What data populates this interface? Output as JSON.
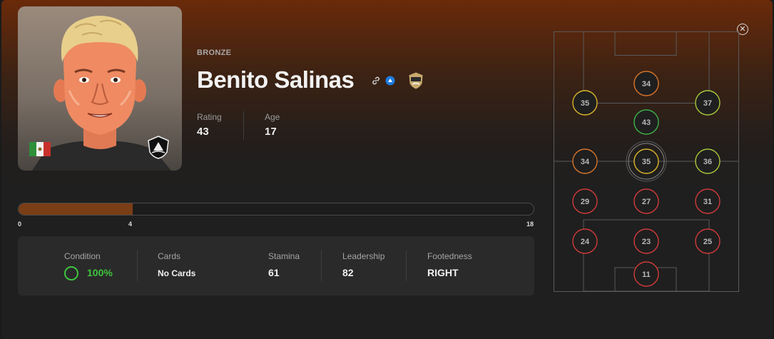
{
  "player": {
    "tier": "BRONZE",
    "name": "Benito Salinas",
    "avatar_icon": "player-portrait",
    "flag_icon": "mexico-flag",
    "club_icon": "club-crest"
  },
  "stats": {
    "rating_label": "Rating",
    "rating_value": "43",
    "age_label": "Age",
    "age_value": "17"
  },
  "progress": {
    "min_label": "0",
    "current_label": "4",
    "max_label": "18",
    "current": 4,
    "max": 18
  },
  "info": {
    "condition_label": "Condition",
    "condition_value": "100%",
    "cards_label": "Cards",
    "cards_value": "No Cards",
    "stamina_label": "Stamina",
    "stamina_value": "61",
    "leadership_label": "Leadership",
    "leadership_value": "82",
    "footedness_label": "Footedness",
    "footedness_value": "RIGHT"
  },
  "colors": {
    "accent": "#7a3e17",
    "condition_green": "#3ec43e",
    "rating_red": "#d23a3a",
    "rating_orange": "#d8742a",
    "rating_yellow": "#d9b52a",
    "rating_lime": "#a8c83a",
    "rating_green": "#3eb04a"
  },
  "positions": [
    {
      "value": "34",
      "color": "orange"
    },
    {
      "value": "35",
      "color": "yellow"
    },
    {
      "value": "37",
      "color": "lime"
    },
    {
      "value": "43",
      "color": "green"
    },
    {
      "value": "34",
      "color": "orange"
    },
    {
      "value": "35",
      "color": "yellow",
      "selected": true
    },
    {
      "value": "36",
      "color": "lime"
    },
    {
      "value": "29",
      "color": "red"
    },
    {
      "value": "27",
      "color": "red"
    },
    {
      "value": "31",
      "color": "red"
    },
    {
      "value": "24",
      "color": "red"
    },
    {
      "value": "23",
      "color": "red"
    },
    {
      "value": "25",
      "color": "red"
    },
    {
      "value": "11",
      "color": "red"
    }
  ]
}
